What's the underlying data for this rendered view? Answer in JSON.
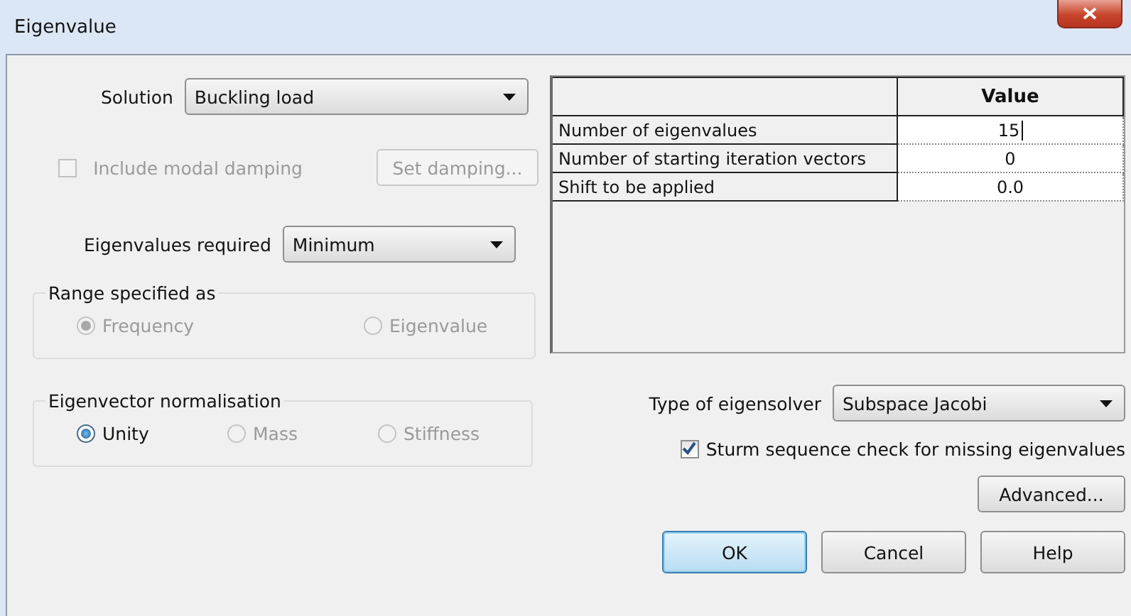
{
  "window": {
    "title": "Eigenvalue"
  },
  "solution": {
    "label": "Solution",
    "value": "Buckling load"
  },
  "modal_damping": {
    "label": "Include modal damping",
    "checked": false,
    "disabled": true
  },
  "set_damping_button": {
    "label": "Set damping...",
    "disabled": true
  },
  "eigenvalues_required": {
    "label": "Eigenvalues required",
    "value": "Minimum"
  },
  "range_group": {
    "title": "Range specified as",
    "options": [
      {
        "label": "Frequency",
        "selected": true,
        "disabled": true
      },
      {
        "label": "Eigenvalue",
        "selected": false,
        "disabled": true
      }
    ]
  },
  "normalisation_group": {
    "title": "Eigenvector normalisation",
    "options": [
      {
        "label": "Unity",
        "selected": true,
        "disabled": false
      },
      {
        "label": "Mass",
        "selected": false,
        "disabled": true
      },
      {
        "label": "Stiffness",
        "selected": false,
        "disabled": true
      }
    ]
  },
  "table": {
    "value_heading": "Value",
    "rows": [
      {
        "name": "Number of eigenvalues",
        "value": "15",
        "editing": true
      },
      {
        "name": "Number of starting iteration vectors",
        "value": "0",
        "editing": false
      },
      {
        "name": "Shift to be applied",
        "value": "0.0",
        "editing": false
      }
    ]
  },
  "eigensolver": {
    "label": "Type of eigensolver",
    "value": "Subspace Jacobi"
  },
  "sturm_check": {
    "label": "Sturm sequence check for missing eigenvalues",
    "checked": true,
    "disabled": false
  },
  "advanced_button": {
    "label": "Advanced..."
  },
  "buttons": [
    {
      "label": "OK",
      "default": true
    },
    {
      "label": "Cancel",
      "default": false
    },
    {
      "label": "Help",
      "default": false
    }
  ]
}
